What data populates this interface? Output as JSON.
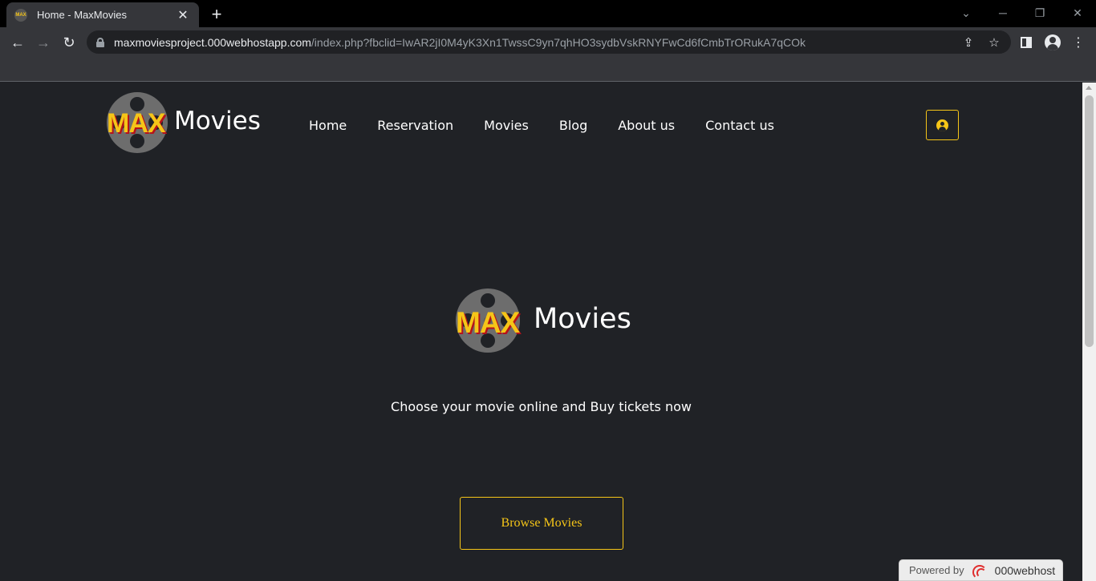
{
  "browser": {
    "tab_title": "Home - MaxMovies",
    "tab_favicon_text": "MAX",
    "url_host": "maxmoviesproject.000webhostapp.com",
    "url_path": "/index.php?fbclid=IwAR2jI0M4yK3Xn1TwssC9yn7qhHO3sydbVskRNYFwCd6fCmbTrORukA7qCOk"
  },
  "site": {
    "logo_max": "MAX",
    "logo_movies": "Movies",
    "nav": [
      "Home",
      "Reservation",
      "Movies",
      "Blog",
      "About us",
      "Contact us"
    ],
    "hero_logo_max": "MAX",
    "hero_logo_movies": "Movies",
    "tagline": "Choose your movie online and Buy tickets now",
    "browse_button": "Browse Movies",
    "accent_color": "#f5c518"
  },
  "footer_badge": {
    "powered_by": "Powered by",
    "brand": "000webhost"
  }
}
